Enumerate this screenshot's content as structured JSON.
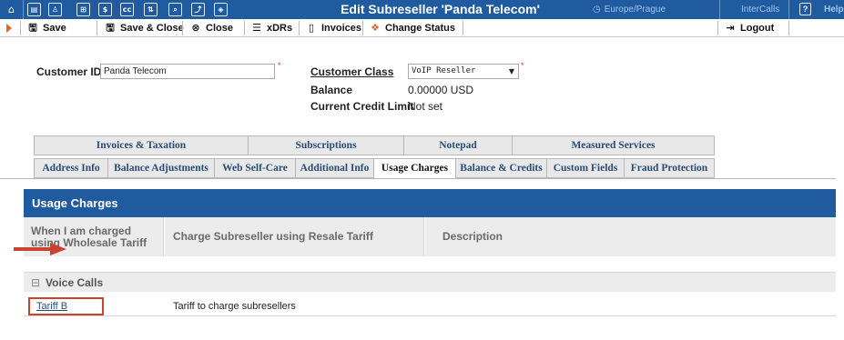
{
  "window": {
    "title": "Edit Subreseller 'Panda Telecom'",
    "timezone": "Europe/Prague",
    "environment": "InterCalls",
    "help_label": "Help"
  },
  "topbar_icons": [
    "home-icon",
    "grid-icon",
    "person-icon",
    "apps-icon",
    "dollar-icon",
    "cc-icon",
    "switch-icon",
    "search-icon",
    "chart-icon",
    "shield-icon"
  ],
  "toolbar": {
    "save": "Save",
    "save_close": "Save & Close",
    "close": "Close",
    "xdrs": "xDRs",
    "invoices": "Invoices",
    "change_status": "Change Status",
    "logout": "Logout"
  },
  "form": {
    "customer_id_label": "Customer ID",
    "customer_id_value": "Panda Telecom",
    "customer_class_label": "Customer Class",
    "customer_class_value": "VoIP Reseller",
    "balance_label": "Balance",
    "balance_value": "0.00000 USD",
    "credit_limit_label": "Current Credit Limit",
    "credit_limit_value": "Not set"
  },
  "tabs_row1": [
    "Invoices & Taxation",
    "Subscriptions",
    "Notepad",
    "Measured Services"
  ],
  "tabs_row2": [
    "Address Info",
    "Balance Adjustments",
    "Web Self-Care",
    "Additional Info",
    "Usage Charges",
    "Balance & Credits",
    "Custom Fields",
    "Fraud Protection"
  ],
  "active_tab": "Usage Charges",
  "usage": {
    "panel_title": "Usage Charges",
    "col1": "When I am charged using Wholesale Tariff",
    "col2": "Charge Subreseller using Resale Tariff",
    "col3": "Description",
    "section_title": "Voice Calls",
    "rows": [
      {
        "tariff": "Tariff B",
        "description": "Tariff to charge subresellers"
      }
    ]
  },
  "colors": {
    "brand_blue": "#1f5b9e",
    "accent_orange": "#e06a1b",
    "highlight_red": "#c9432e"
  }
}
